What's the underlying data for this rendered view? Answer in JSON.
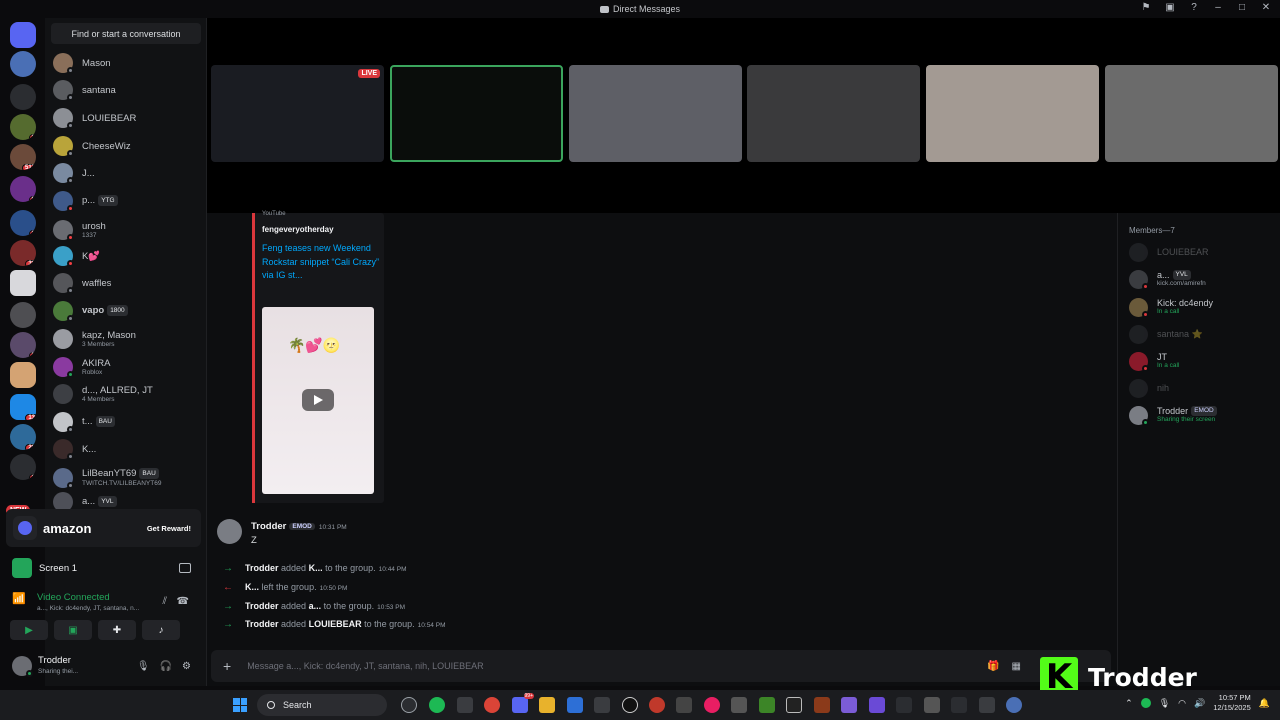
{
  "window": {
    "title": "Direct Messages"
  },
  "sidebar": {
    "search_label": "Find or start a conversation",
    "dms": [
      {
        "name": "Mason",
        "sub": "",
        "tag": ""
      },
      {
        "name": "santana",
        "sub": "",
        "tag": ""
      },
      {
        "name": "LOUIEBEAR",
        "sub": "",
        "tag": ""
      },
      {
        "name": "CheeseWiz",
        "sub": "",
        "tag": ""
      },
      {
        "name": "J...",
        "sub": "",
        "tag": ""
      },
      {
        "name": "p...",
        "sub": "",
        "tag": "YTG"
      },
      {
        "name": "urosh",
        "sub": "1337",
        "tag": ""
      },
      {
        "name": "K💕",
        "sub": "",
        "tag": ""
      },
      {
        "name": "waffles",
        "sub": "",
        "tag": ""
      },
      {
        "name": "vapo",
        "sub": "",
        "tag": "1800"
      },
      {
        "name": "kapz, Mason",
        "sub": "3 Members",
        "tag": ""
      },
      {
        "name": "AKIRA",
        "sub": "Roblox",
        "tag": ""
      },
      {
        "name": "d..., ALLRED, JT",
        "sub": "4 Members",
        "tag": ""
      },
      {
        "name": "t...",
        "sub": "",
        "tag": "BAU"
      },
      {
        "name": "K...",
        "sub": "",
        "tag": ""
      },
      {
        "name": "LilBeanYT69",
        "sub": "TWITCH.TV/LILBEANYT69",
        "tag": "BAU"
      },
      {
        "name": "a...",
        "sub": "",
        "tag": "YVL"
      }
    ],
    "new_label": "NEW",
    "promo": {
      "brand": "amazon",
      "action": "Get Reward!"
    },
    "screen_label": "Screen 1",
    "voice": {
      "status": "Video Connected",
      "members": "a..., Kick: dc4endy, JT, santana, n..."
    },
    "user": {
      "name": "Trodder",
      "status": "Sharing thei..."
    }
  },
  "rail_badges": [
    "3",
    "517",
    "9",
    "2",
    "36",
    "7",
    "13",
    "28",
    "1"
  ],
  "stage": {
    "live_label": "LIVE"
  },
  "chat": {
    "embed": {
      "source": "YouTube",
      "author": "fengeveryotherday",
      "title": "Feng teases new Weekend Rockstar snippet “Cali Crazy” via IG st..."
    },
    "message": {
      "author": "Trodder",
      "role": "EMOD",
      "time": "10:31 PM",
      "text": "Z"
    },
    "events": [
      {
        "dir": "in",
        "actor": "Trodder",
        "verb": "added",
        "target": "K...",
        "rest": "to the group.",
        "time": "10:44 PM"
      },
      {
        "dir": "out",
        "actor": "K...",
        "verb": "left the group.",
        "target": "",
        "rest": "",
        "time": "10:50 PM"
      },
      {
        "dir": "in",
        "actor": "Trodder",
        "verb": "added",
        "target": "a...",
        "rest": "to the group.",
        "time": "10:53 PM"
      },
      {
        "dir": "in",
        "actor": "Trodder",
        "verb": "added",
        "target": "LOUIEBEAR",
        "rest": "to the group.",
        "time": "10:54 PM"
      }
    ],
    "composer_placeholder": "Message a..., Kick: dc4endy, JT, santana, nih, LOUIEBEAR"
  },
  "members": {
    "header": "Members—7",
    "list": [
      {
        "name": "LOUIEBEAR",
        "sub": "",
        "tag": "",
        "offline": true
      },
      {
        "name": "a...",
        "sub": "kick.com/amirefn",
        "tag": "YVL",
        "offline": false
      },
      {
        "name": "Kick: dc4endy",
        "sub": "In a call",
        "tag": "",
        "offline": false
      },
      {
        "name": "santana ⭐",
        "sub": "",
        "tag": "",
        "offline": true
      },
      {
        "name": "JT",
        "sub": "In a call",
        "tag": "",
        "offline": false
      },
      {
        "name": "nih",
        "sub": "",
        "tag": "",
        "offline": true
      },
      {
        "name": "Trodder",
        "sub": "Sharing their screen",
        "tag": "EMOD",
        "offline": false
      }
    ]
  },
  "watermark": {
    "name": "Trodder"
  },
  "taskbar": {
    "search_label": "Search",
    "time": "10:57 PM",
    "date": "12/15/2025",
    "notification_badge": "99+"
  },
  "colors": {
    "accent": "#5865f2",
    "online": "#23a55a",
    "danger": "#da373c",
    "link": "#00a8fc",
    "kick": "#53fc18"
  }
}
